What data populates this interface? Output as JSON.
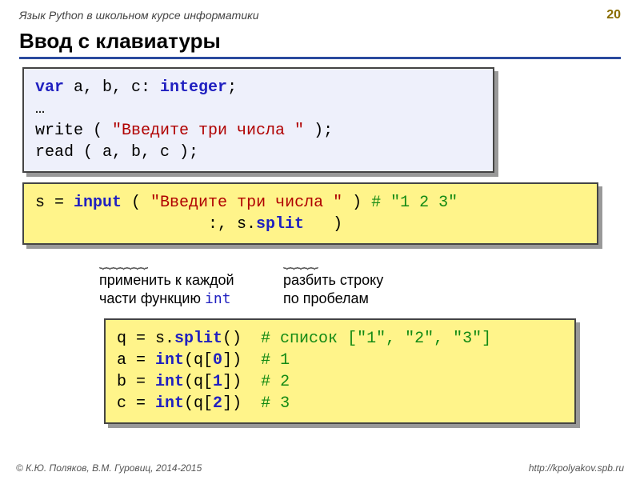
{
  "header": {
    "subject": "Язык Python в школьном курсе информатики",
    "page": "20"
  },
  "title": "Ввод с клавиатуры",
  "pascal": {
    "l1_a": "var",
    "l1_b": " a, b, c: ",
    "l1_c": "integer",
    "l1_d": ";",
    "l2": "…",
    "l3_a": "write ( ",
    "l3_b": "\"Введите три числа \"",
    "l3_c": " );",
    "l4": "read ( a, b, c );"
  },
  "py1": {
    "l1_a": "s = ",
    "l1_b": "input",
    "l1_c": " ( ",
    "l1_d": "\"Введите три числа \"",
    "l1_e": " ) ",
    "l1_f": "# \"1 2 3\"",
    "l2_a": "                  :, s.",
    "l2_b": "split",
    "l2_c": "   )"
  },
  "annot": {
    "brace1": "⏟⏟⏟⏟⏟⏟⏟",
    "brace2": "⏟⏟⏟⏟⏟",
    "col1_line1": "применить к каждой",
    "col1_line2_a": "части функцию ",
    "col1_line2_b": "int",
    "col2_line1": "разбить строку",
    "col2_line2": "по пробелам"
  },
  "py2": {
    "l1_a": "q = s.",
    "l1_b": "split",
    "l1_c": "()  ",
    "l1_d": "# список [\"1\", \"2\", \"3\"]",
    "l2_a": "a = ",
    "l2_b": "int",
    "l2_c": "(q[",
    "l2_d": "0",
    "l2_e": "])  ",
    "l2_f": "# 1",
    "l3_a": "b = ",
    "l3_b": "int",
    "l3_c": "(q[",
    "l3_d": "1",
    "l3_e": "])  ",
    "l3_f": "# 2",
    "l4_a": "c = ",
    "l4_b": "int",
    "l4_c": "(q[",
    "l4_d": "2",
    "l4_e": "])  ",
    "l4_f": "# 3"
  },
  "footer": {
    "left": "© К.Ю. Поляков, В.М. Гуровиц, 2014-2015",
    "right": "http://kpolyakov.spb.ru"
  }
}
